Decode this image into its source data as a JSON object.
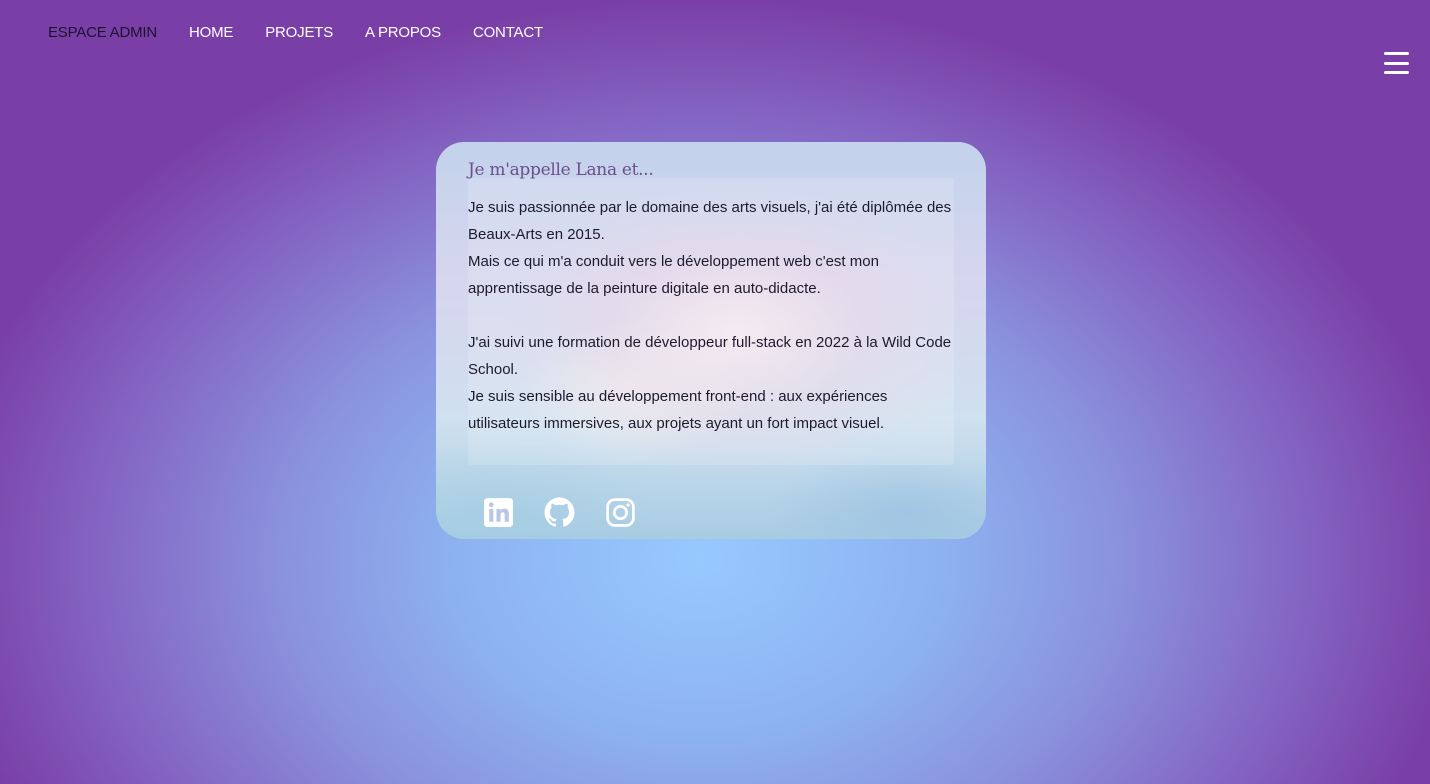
{
  "nav": {
    "items": [
      {
        "label": "ESPACE ADMIN"
      },
      {
        "label": "HOME"
      },
      {
        "label": "PROJETS"
      },
      {
        "label": "A PROPOS"
      },
      {
        "label": "CONTACT"
      }
    ],
    "menu_icon": "hamburger-menu-icon"
  },
  "card": {
    "title": "Je m'appelle Lana et...",
    "paragraphs": [
      "Je suis passionnée par le domaine des arts visuels, j'ai été diplômée des Beaux-Arts en 2015.",
      "Mais ce qui m'a conduit vers le développement web c'est mon apprentissage de la peinture digitale en auto-didacte.",
      "J'ai suivi une formation de développeur full-stack en 2022 à la Wild Code School.",
      "Je suis sensible au développement front-end : aux expériences utilisateurs immersives, aux projets ayant un fort impact visuel."
    ],
    "socials": [
      {
        "icon": "linkedin-icon"
      },
      {
        "icon": "github-icon"
      },
      {
        "icon": "instagram-icon"
      }
    ]
  },
  "colors": {
    "nav_text": "#ffffff",
    "admin_text": "#1c1230",
    "title": "#6b4f8a",
    "body_text": "#1e1a2e",
    "background_center": "#97c9ff",
    "background_edge": "#7a3fa6"
  }
}
